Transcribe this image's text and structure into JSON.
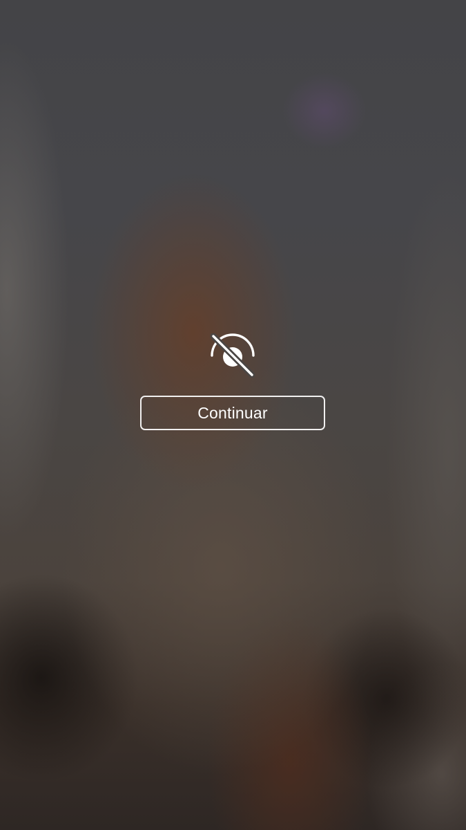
{
  "overlay": {
    "icon": "eye-slash-icon",
    "continue_label": "Continuar"
  },
  "colors": {
    "foreground": "#ffffff"
  }
}
